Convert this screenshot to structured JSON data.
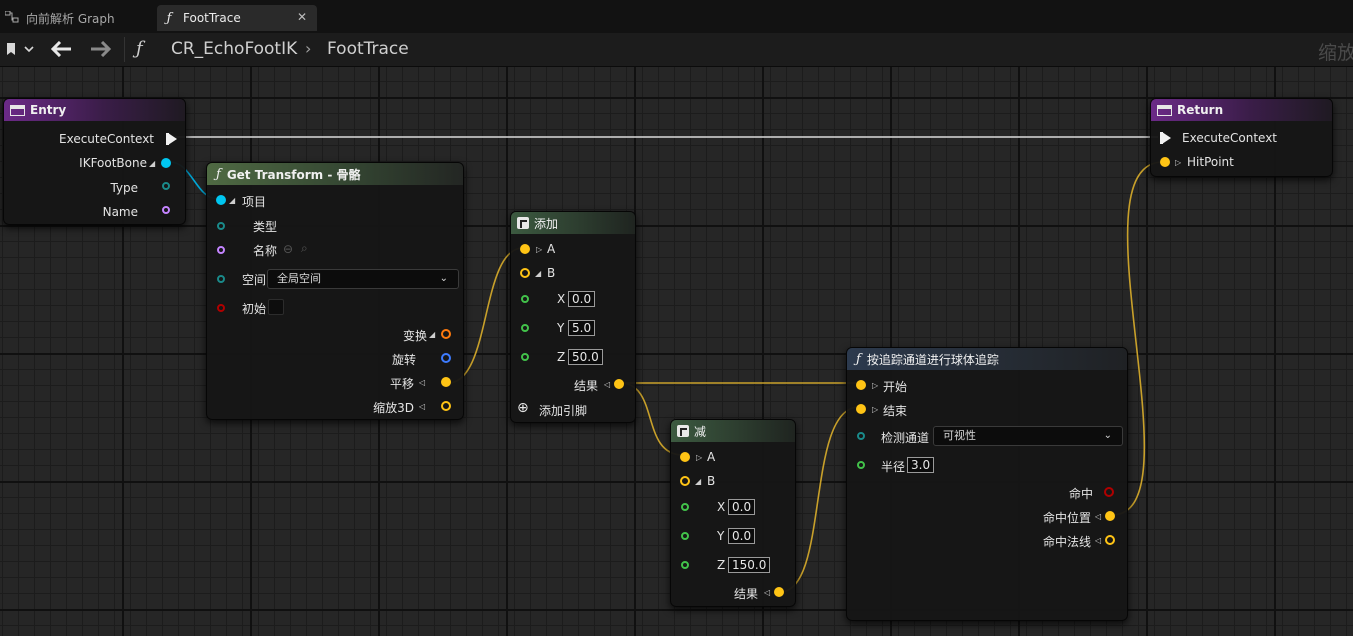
{
  "tabs": [
    {
      "label": "向前解析 Graph",
      "icon": "graph-icon",
      "active": false
    },
    {
      "label": "FootTrace",
      "icon": "function-icon",
      "active": true
    }
  ],
  "breadcrumb": {
    "blueprint": "CR_EchoFootIK",
    "separator": "›",
    "function": "FootTrace"
  },
  "zoom_label": "缩放",
  "colors": {
    "exec": "#f2f2f2",
    "struct": "#00a8d8",
    "name": "#c484ff",
    "bool": "#b00000",
    "vector": "#ffc415",
    "rotator": "#3d7bff",
    "transform": "#ff7a0e",
    "float": "#42c24a",
    "type": "#1a8a8a",
    "wire_vector": "#c8a02a",
    "wire_exec": "#e6e6e6"
  },
  "nodes": {
    "entry": {
      "title": "Entry",
      "pins": {
        "execute": "ExecuteContext",
        "bone": "IKFootBone",
        "type": "Type",
        "name": "Name"
      }
    },
    "get_transform": {
      "title": "Get Transform - 骨骼",
      "item": "项目",
      "type": "类型",
      "name": "名称",
      "space_label": "空间",
      "space_value": "全局空间",
      "initial": "初始",
      "initial_checked": false,
      "out_transform": "变换",
      "out_rotation": "旋转",
      "out_translation": "平移",
      "out_scale": "缩放3D"
    },
    "add": {
      "title": "添加",
      "a": "A",
      "b": "B",
      "x_label": "X",
      "x": "0.0",
      "y_label": "Y",
      "y": "5.0",
      "z_label": "Z",
      "z": "50.0",
      "result": "结果",
      "add_pin": "添加引脚"
    },
    "subtract": {
      "title": "减",
      "a": "A",
      "b": "B",
      "x_label": "X",
      "x": "0.0",
      "y_label": "Y",
      "y": "0.0",
      "z_label": "Z",
      "z": "150.0",
      "result": "结果"
    },
    "trace": {
      "title": "按追踪通道进行球体追踪",
      "start": "开始",
      "end": "结束",
      "channel_label": "检测通道",
      "channel_value": "可视性",
      "radius_label": "半径",
      "radius": "3.0",
      "hit": "命中",
      "hit_location": "命中位置",
      "hit_normal": "命中法线"
    },
    "return": {
      "title": "Return",
      "execute": "ExecuteContext",
      "hit_point": "HitPoint"
    }
  }
}
